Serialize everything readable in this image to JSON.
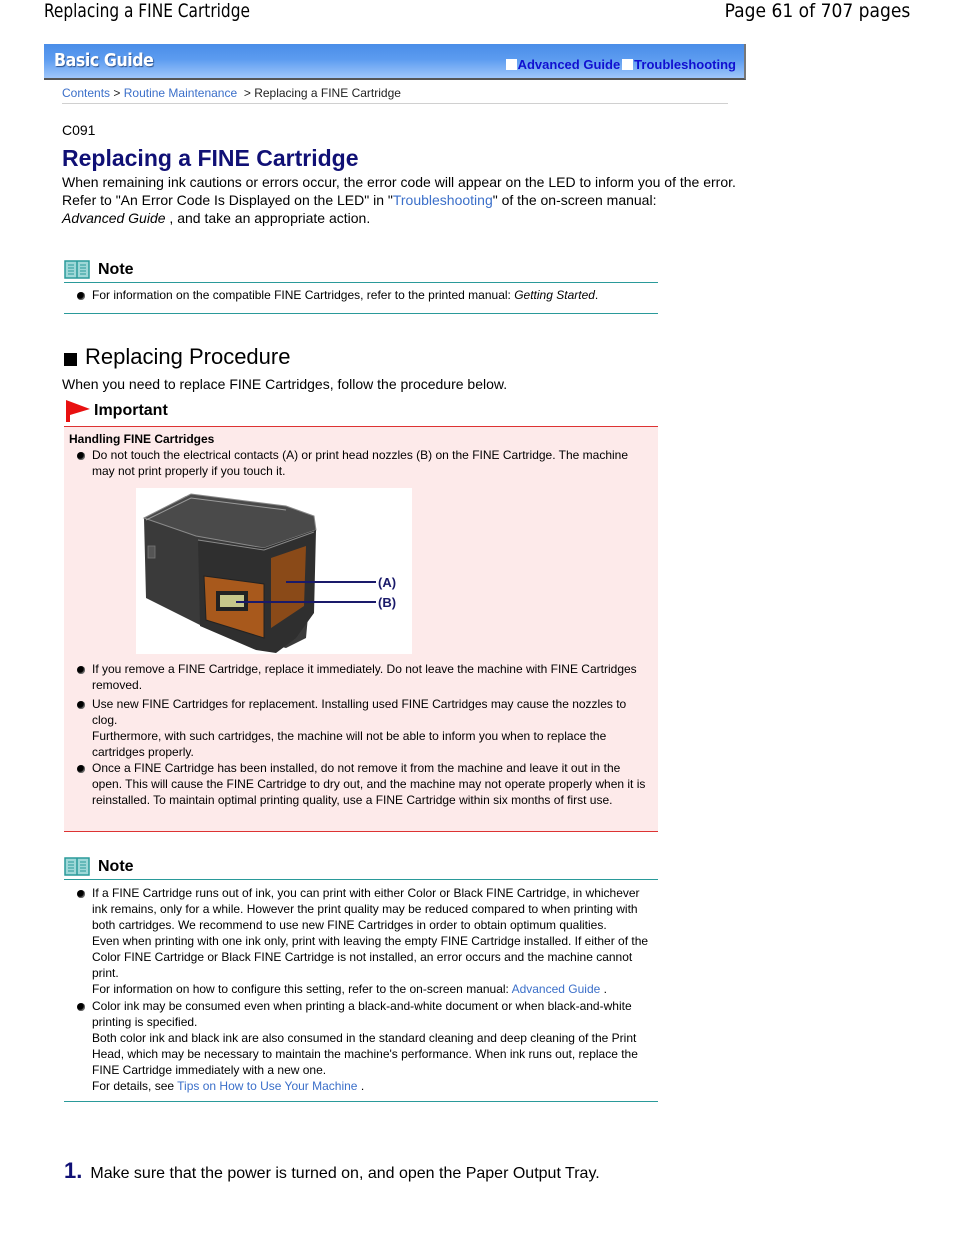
{
  "page_header": {
    "title": "Replacing a FINE Cartridge",
    "page_count": "Page 61 of 707 pages"
  },
  "banner": {
    "title": "Basic Guide",
    "links": [
      "Advanced Guide",
      "Troubleshooting"
    ]
  },
  "breadcrumb": {
    "items": [
      "Contents",
      "Routine Maintenance"
    ],
    "separator": ">",
    "current": "Replacing a FINE Cartridge"
  },
  "doc": {
    "code": "C091",
    "title": "Replacing a FINE Cartridge",
    "intro_line1": "When remaining ink cautions or errors occur, the error code will appear on the LED to inform you of the error.",
    "intro_line2_pre": "Refer to \"An Error Code Is Displayed on the LED\" in \"",
    "intro_link": "Troubleshooting",
    "intro_line2_post": "\" of the on-screen manual:",
    "intro_italic": "Advanced Guide",
    "intro_line3_post": " , and take an appropriate action."
  },
  "note1": {
    "heading": "Note",
    "bullet_text": "For information on the compatible FINE Cartridges, refer to the printed manual: ",
    "bullet_italic": "Getting Started",
    "bullet_end": "."
  },
  "section": {
    "heading": "Replacing Procedure",
    "intro": "When you need to replace FINE Cartridges, follow the procedure below."
  },
  "important": {
    "heading": "Important",
    "subheading": "Handling FINE Cartridges",
    "bullets": [
      [
        "Do not touch the electrical contacts (A) or print head nozzles (B) on the FINE Cartridge. The machine may not print properly if you touch it."
      ],
      [
        "If you remove a FINE Cartridge, replace it immediately. Do not leave the machine with FINE Cartridges removed."
      ],
      [
        "Use new FINE Cartridges for replacement. Installing used FINE Cartridges may cause the nozzles to clog.",
        "Furthermore, with such cartridges, the machine will not be able to inform you when to replace the cartridges properly."
      ],
      [
        "Once a FINE Cartridge has been installed, do not remove it from the machine and leave it out in the open. This will cause the FINE Cartridge to dry out, and the machine may not operate properly when it is reinstalled. To maintain optimal printing quality, use a FINE Cartridge within six months of first use."
      ]
    ],
    "image_labels": [
      "(A)",
      "(B)"
    ]
  },
  "note2": {
    "heading": "Note",
    "b1_p1": "If a FINE Cartridge runs out of ink, you can print with either Color or Black FINE Cartridge, in whichever ink remains, only for a while. However the print quality may be reduced compared to when printing with both cartridges. We recommend to use new FINE Cartridges in order to obtain optimum qualities.",
    "b1_p2": "Even when printing with one ink only, print with leaving the empty FINE Cartridge installed. If either of the Color FINE Cartridge or Black FINE Cartridge is not installed, an error occurs and the machine cannot print.",
    "b1_p3_pre": "For information on how to configure this setting, refer to the on-screen manual: ",
    "b1_p3_link": "Advanced Guide",
    "b1_p3_post": " .",
    "b2_p1": "Color ink may be consumed even when printing a black-and-white document or when black-and-white printing is specified.",
    "b2_p2": "Both color ink and black ink are also consumed in the standard cleaning and deep cleaning of the Print Head, which may be necessary to maintain the machine's performance. When ink runs out, replace the FINE Cartridge immediately with a new one.",
    "b2_p3_pre": "For details, see ",
    "b2_p3_link": "Tips on How to Use Your Machine",
    "b2_p3_post": " ."
  },
  "steps": [
    {
      "number": "1.",
      "text": "Make sure that the power is turned on, and open the Paper Output Tray."
    }
  ]
}
